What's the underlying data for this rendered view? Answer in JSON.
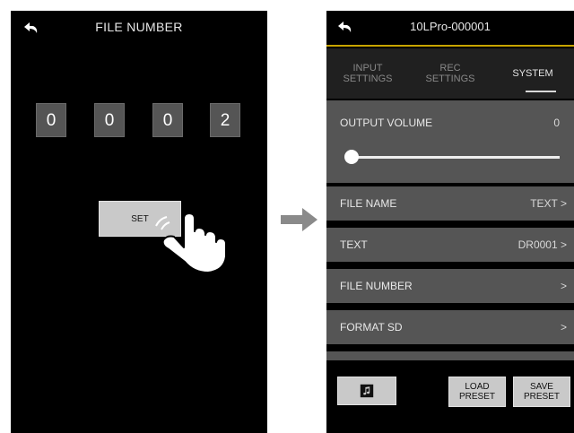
{
  "left_screen": {
    "title": "FILE NUMBER",
    "digits": [
      "0",
      "0",
      "0",
      "2"
    ],
    "set_button_label": "SET"
  },
  "right_screen": {
    "title": "10LPro-000001",
    "tabs": [
      {
        "label": "INPUT\nSETTINGS",
        "active": false
      },
      {
        "label": "REC\nSETTINGS",
        "active": false
      },
      {
        "label": "SYSTEM",
        "active": true
      }
    ],
    "output_volume": {
      "label": "OUTPUT VOLUME",
      "value": "0",
      "level": 0
    },
    "menu_items": [
      {
        "label": "FILE NAME",
        "value": "TEXT"
      },
      {
        "label": "TEXT",
        "value": "DR0001"
      },
      {
        "label": "FILE NUMBER",
        "value": ""
      },
      {
        "label": "FORMAT SD",
        "value": ""
      }
    ],
    "bottom_buttons": {
      "music_icon": "music-note-icon",
      "load_preset_label": "LOAD\nPRESET",
      "save_preset_label": "SAVE\nPRESET"
    }
  },
  "colors": {
    "screen_bg": "#000000",
    "row_bg": "#555555",
    "button_bg": "#c9c9c9",
    "accent": "#c8a400"
  }
}
